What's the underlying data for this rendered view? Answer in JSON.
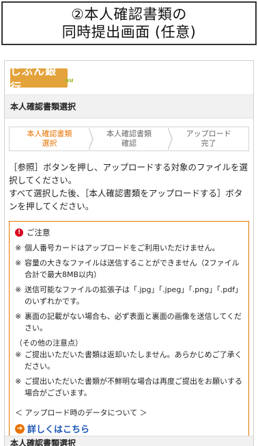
{
  "caption": {
    "line1": "②本人確認書類の",
    "line2": "同時提出画面 (任意)"
  },
  "header": {
    "logo_text": "じぶん銀行",
    "logo_badge": "au"
  },
  "section": {
    "title": "本人確認書類選択"
  },
  "steps": [
    {
      "label": "本人確認書類\n選択",
      "active": true
    },
    {
      "label": "本人確認書類\n確認",
      "active": false
    },
    {
      "label": "アップロード\n完了",
      "active": false
    }
  ],
  "instructions": {
    "line1": "［参照］ボタンを押し、アップロードする対象のファイルを選択してください。",
    "line2": "すべて選択した後、［本人確認書類をアップロードする］ボタンを押してください。"
  },
  "notice": {
    "heading": "ご注意",
    "items": [
      "個人番号カードはアップロードをご利用いただけません。",
      "容量の大きなファイルは送信することができません（2ファイル合計で最大8MB以内）",
      "送信可能なファイルの拡張子は「.jpg」「.jpeg」「.png」「.pdf」のいずれかです。",
      "裏面の記載がない場合も、必ず表面と裏面の画像を送信してください。"
    ],
    "other_heading": "（その他の注意点）",
    "other_items": [
      "ご提出いただいた書類は返却いたしません。あらかじめご了承ください。",
      "ご提出いただいた書類が不鮮明な場合は再度ご提出をお願いする場合がございます。"
    ],
    "note_mark": "※",
    "data_label": "＜ アップロード時のデータについて ＞",
    "link_text": "詳しくはこちら"
  },
  "bottom": {
    "title": "本人確認書類選択"
  },
  "colors": {
    "accent": "#e67300",
    "link": "#1b56b6",
    "logo": "#e3a23a"
  }
}
